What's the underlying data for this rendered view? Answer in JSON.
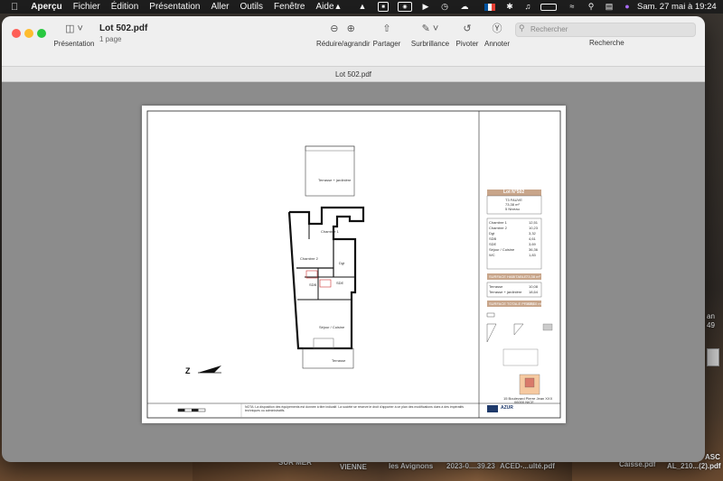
{
  "menubar": {
    "apple": "",
    "app": "Aperçu",
    "items": [
      "Fichier",
      "Édition",
      "Présentation",
      "Aller",
      "Outils",
      "Fenêtre",
      "Aide"
    ],
    "datetime": "Sam. 27 mai à 19:24"
  },
  "window": {
    "title": "Lot 502.pdf",
    "subtitle": "1 page",
    "doc_tab": "Lot 502.pdf",
    "toolbar": {
      "presentation_label": "Présentation",
      "resize_label": "Réduire/agrandir",
      "share_label": "Partager",
      "highlight_label": "Surbrillance",
      "rotate_label": "Pivoter",
      "annotate_label": "Annoter",
      "search_label": "Recherche",
      "search_placeholder": "Rechercher"
    }
  },
  "document": {
    "lot_title": "Lot N°502",
    "type": "T3 FAUVE",
    "surface": "73,38 m²",
    "floor": "5 Niveau",
    "rooms": [
      {
        "name": "Chambre 1",
        "area": "12,51"
      },
      {
        "name": "Chambre 2",
        "area": "10,23"
      },
      {
        "name": "Dgt",
        "area": "3,32"
      },
      {
        "name": "SDB",
        "area": "4,61"
      },
      {
        "name": "SDE",
        "area": "3,69"
      },
      {
        "name": "Séjour / Cuisine",
        "area": "36,36"
      },
      {
        "name": "WC",
        "area": "1,83"
      }
    ],
    "surface_habitable_label": "SURFACE HABITABLE",
    "surface_habitable_value": "73,38 m²",
    "terraces": [
      {
        "name": "Terrasse",
        "area": "10,08"
      },
      {
        "name": "Terrasse + jardinière",
        "area": "18,64"
      }
    ],
    "surface_totale_label": "SURFACE TOTALE PRIVEE",
    "surface_totale_value": "102,10 m²",
    "plan_labels": {
      "terrace_top": "Terrasse + jardinière",
      "chambre1": "Chambre 1",
      "chambre2": "Chambre 2",
      "sdb": "SDB",
      "sde": "SDE",
      "dgt": "Dgt",
      "sejour": "Séjour / Cuisine",
      "terrace_bottom": "Terrasse"
    },
    "north_letter": "Z",
    "brand": "AZUR",
    "address": "15 Boulevard Pierre Jean XXX",
    "city": "06000 NICE",
    "note": "NOTA: La disposition des équipements est donnée à titre indicatif. La société se réserve le droit d'apporter à ce plan des modifications dues à des impératifs techniques ou administratifs."
  },
  "desktop": {
    "labels": [
      "SUR MER",
      "VIENNE",
      "les Avignons",
      "2023-0....39.23",
      "ACED-...ulté.pdf",
      "Caisse.pdf",
      "ASC",
      "AL_210...(2).pdf"
    ],
    "side_labels": [
      "an",
      "49"
    ]
  },
  "colors": {
    "lot_header": "#c8a58a",
    "menubar_bg": "#1e1e1e",
    "toolbar_bg": "#efefef",
    "canvas_bg": "#8c8c8c"
  }
}
